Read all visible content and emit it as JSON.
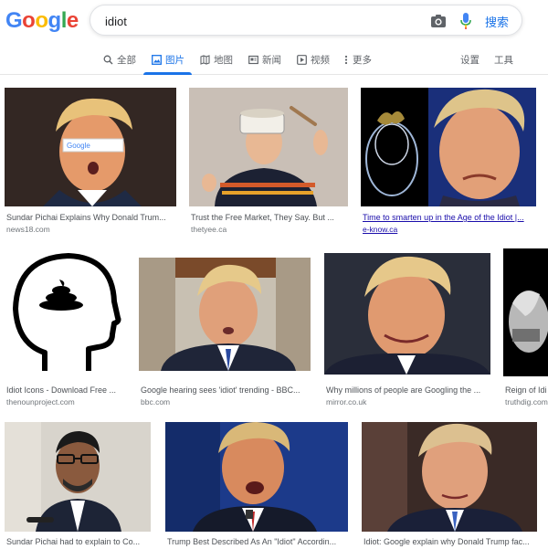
{
  "logo": {
    "letters": [
      "G",
      "o",
      "o",
      "g",
      "l",
      "e"
    ],
    "colors": [
      "#4285F4",
      "#EA4335",
      "#FBBC05",
      "#4285F4",
      "#34A853",
      "#EA4335"
    ]
  },
  "search": {
    "query": "idiot",
    "button_label": "搜索"
  },
  "tabs": [
    {
      "label": "全部",
      "icon": "search-icon"
    },
    {
      "label": "图片",
      "icon": "image-icon",
      "active": true
    },
    {
      "label": "地图",
      "icon": "map-icon"
    },
    {
      "label": "新闻",
      "icon": "news-icon"
    },
    {
      "label": "视频",
      "icon": "video-icon"
    },
    {
      "label": "更多",
      "icon": "more-icon"
    }
  ],
  "tools": {
    "settings": "设置",
    "tools": "工具"
  },
  "results": [
    {
      "title": "Sundar Pichai Explains Why Donald Trum...",
      "source": "news18.com"
    },
    {
      "title": "Trust the Free Market, They Say. But ...",
      "source": "thetyee.ca"
    },
    {
      "title": "Time to smarten up in the Age of the Idiot |...",
      "source": "e-know.ca"
    },
    {
      "title": "Idiot Icons - Download Free ...",
      "source": "thenounproject.com"
    },
    {
      "title": "Google hearing sees 'idiot' trending - BBC...",
      "source": "bbc.com"
    },
    {
      "title": "Why millions of people are Googling the ...",
      "source": "mirror.co.uk"
    },
    {
      "title": "Reign of Idi",
      "source": "truthdig.com"
    },
    {
      "title": "Sundar Pichai had to explain to Co...",
      "source": ""
    },
    {
      "title": "Trump Best Described As An \"Idiot\" Accordin...",
      "source": ""
    },
    {
      "title": "Idiot: Google explain why Donald Trump fac...",
      "source": ""
    }
  ],
  "image_text": {
    "google_bar": "Google"
  },
  "colors": {
    "accent": "#1a73e8",
    "link": "#1a0dab"
  }
}
